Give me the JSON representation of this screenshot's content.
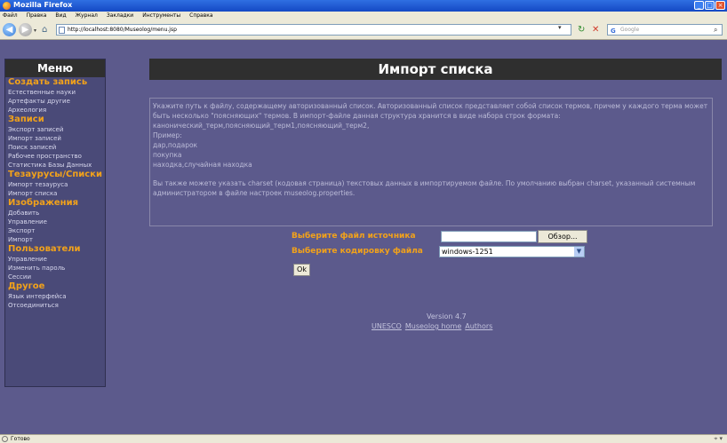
{
  "window": {
    "title": "Mozilla Firefox"
  },
  "menubar": [
    "Файл",
    "Правка",
    "Вид",
    "Журнал",
    "Закладки",
    "Инструменты",
    "Справка"
  ],
  "navbar": {
    "url": "http://localhost:8080/Museolog/menu.jsp",
    "search_placeholder": "Google"
  },
  "sidebar": {
    "title": "Меню",
    "sections": [
      {
        "label": "Создать запись",
        "items": [
          "Естественные науки",
          "Артефакты другие",
          "Археология"
        ]
      },
      {
        "label": "Записи",
        "items": [
          "Экспорт записей",
          "Импорт записей",
          "Поиск записей",
          "Рабочее пространство",
          "Статистика Базы Данных"
        ]
      },
      {
        "label": "Тезаурусы/Списки",
        "items": [
          "Импорт тезауруса",
          "Импорт списка"
        ]
      },
      {
        "label": "Изображения",
        "items": [
          "Добавить",
          "Управление",
          "Экспорт",
          "Импорт"
        ]
      },
      {
        "label": "Пользователи",
        "items": [
          "Управление",
          "Изменить пароль",
          "Сессии"
        ]
      },
      {
        "label": "Другое",
        "items": [
          "Язык интерфейса",
          "Отсоединиться"
        ]
      }
    ]
  },
  "main": {
    "heading": "Импорт списка",
    "info": {
      "p1": "Укажите путь к файлу, содержащему авторизованный список. Авторизованный список представляет собой список термов, причем у каждого терма может быть несколько \"поясняющих\" термов. В импорт-файле данная структура хранится в виде набора строк формата: канонический_терм,поясняющий_терм1,поясняющий_терм2,",
      "example_label": "Пример:",
      "ex1": "дар,подарок",
      "ex2": "покупка",
      "ex3": "находка,случайная находка",
      "p2": "Вы также можете указать charset (кодовая страница) текстовых данных в импортируемом файле. По умолчанию выбран charset, указанный системным администратором в файле настроек museolog.properties."
    },
    "form": {
      "file_label": "Выберите файл источника",
      "browse_label": "Обзор...",
      "encoding_label": "Выберите кодировку файла",
      "encoding_value": "windows-1251",
      "ok_label": "Ok"
    },
    "footer": {
      "version": "Version 4.7",
      "links": [
        "UNESCO",
        "Museolog home",
        "Authors"
      ]
    }
  },
  "status": {
    "text": "Готово"
  }
}
